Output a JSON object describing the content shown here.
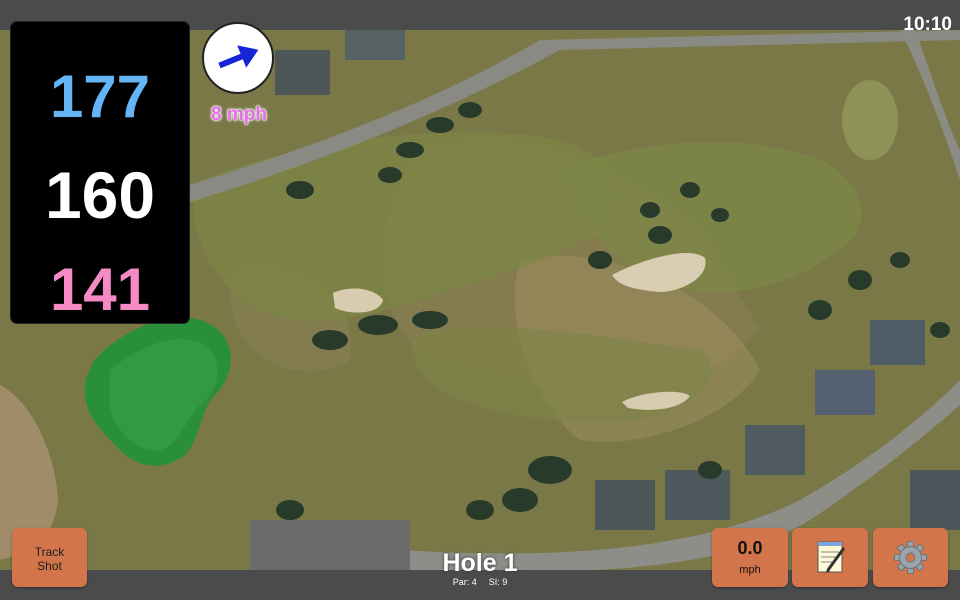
{
  "status": {
    "time": "10:10"
  },
  "distances": {
    "back": "177",
    "center": "160",
    "front": "141"
  },
  "wind": {
    "speed_label": "8 mph",
    "direction_icon": "wind-arrow-icon"
  },
  "hole": {
    "title": "Hole 1",
    "par": "Par: 4",
    "stroke_index": "SI: 9"
  },
  "buttons": {
    "track_shot_line1": "Track",
    "track_shot_line2": "Shot",
    "speed_value": "0.0",
    "speed_unit": "mph",
    "notes_icon": "notepad-icon",
    "settings_icon": "gear-icon"
  },
  "colors": {
    "back_distance": "#64b4f6",
    "center_distance": "#ffffff",
    "front_distance": "#f68ac6",
    "wind_label": "#e36ee6",
    "button": "#d2754a"
  }
}
